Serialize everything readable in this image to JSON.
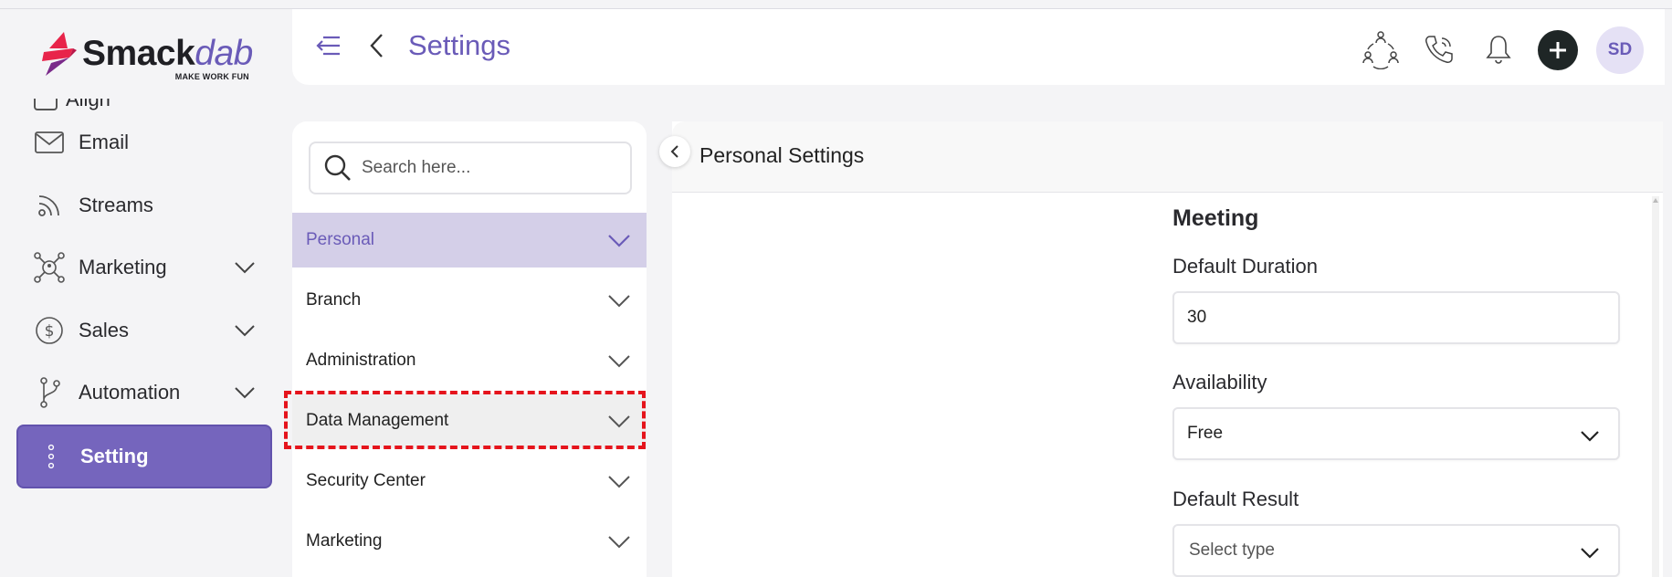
{
  "brand": {
    "name_part1": "Smack",
    "name_part2": "dab",
    "tagline": "MAKE WORK FUN",
    "colors": {
      "accent": "#6a5bb8",
      "red": "#e5141c",
      "mark_red": "#e8244a"
    }
  },
  "sidebar": {
    "partial_item_label": "Align",
    "items": [
      {
        "label": "Email",
        "icon": "mail-icon",
        "has_chevron": false,
        "active": false
      },
      {
        "label": "Streams",
        "icon": "rss-icon",
        "has_chevron": false,
        "active": false
      },
      {
        "label": "Marketing",
        "icon": "marketing-network-icon",
        "has_chevron": true,
        "active": false
      },
      {
        "label": "Sales",
        "icon": "dollar-coin-icon",
        "has_chevron": true,
        "active": false
      },
      {
        "label": "Automation",
        "icon": "branch-icon",
        "has_chevron": true,
        "active": false
      },
      {
        "label": "Setting",
        "icon": "kebab-dots-icon",
        "has_chevron": false,
        "active": true
      }
    ]
  },
  "header": {
    "title": "Settings",
    "avatar_initials": "SD",
    "icons": [
      "menu-collapse-icon",
      "back-chevron-icon",
      "team-network-icon",
      "phone-icon",
      "bell-icon",
      "plus-icon"
    ]
  },
  "settings_menu": {
    "search_placeholder": "Search here...",
    "items": [
      {
        "label": "Personal",
        "state": "selected"
      },
      {
        "label": "Branch",
        "state": "normal"
      },
      {
        "label": "Administration",
        "state": "normal"
      },
      {
        "label": "Data Management",
        "state": "hover"
      },
      {
        "label": "Security Center",
        "state": "normal"
      },
      {
        "label": "Marketing",
        "state": "normal"
      }
    ]
  },
  "content": {
    "title": "Personal Settings",
    "section_heading": "Meeting",
    "fields": {
      "default_duration": {
        "label": "Default Duration",
        "value": "30"
      },
      "availability": {
        "label": "Availability",
        "value": "Free"
      },
      "default_result": {
        "label": "Default Result",
        "placeholder": "Select type"
      }
    }
  }
}
